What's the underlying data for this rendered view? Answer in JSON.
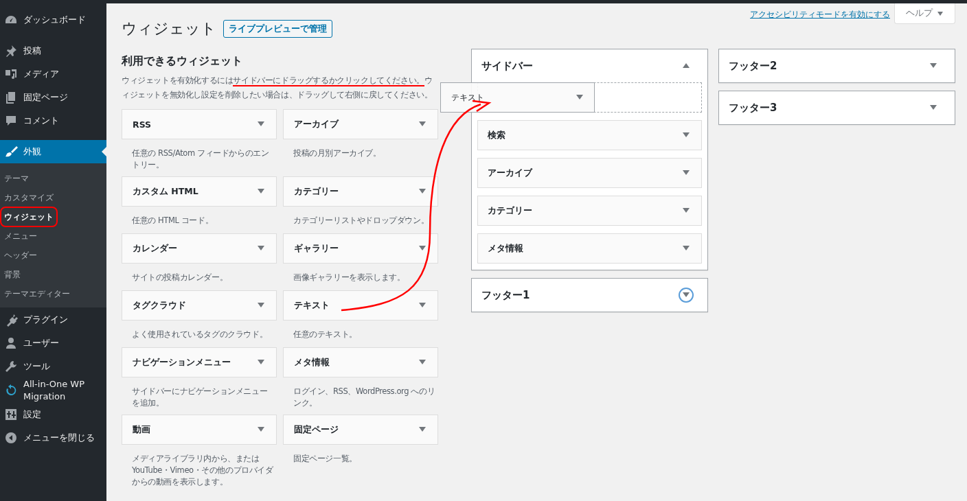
{
  "admin_menu": {
    "items": [
      {
        "label": "ダッシュボード",
        "selected": false
      },
      {
        "label": "投稿",
        "selected": false
      },
      {
        "label": "メディア",
        "selected": false
      },
      {
        "label": "固定ページ",
        "selected": false
      },
      {
        "label": "コメント",
        "selected": false
      },
      {
        "label": "外観",
        "selected": true,
        "submenu": [
          {
            "label": "テーマ",
            "selected": false,
            "circled": false
          },
          {
            "label": "カスタマイズ",
            "selected": false,
            "circled": false
          },
          {
            "label": "ウィジェット",
            "selected": true,
            "circled": true
          },
          {
            "label": "メニュー",
            "selected": false,
            "circled": false
          },
          {
            "label": "ヘッダー",
            "selected": false,
            "circled": false
          },
          {
            "label": "背景",
            "selected": false,
            "circled": false
          },
          {
            "label": "テーマエディター",
            "selected": false,
            "circled": false
          }
        ]
      },
      {
        "label": "プラグイン",
        "selected": false
      },
      {
        "label": "ユーザー",
        "selected": false
      },
      {
        "label": "ツール",
        "selected": false
      },
      {
        "label": "All-in-One WP Migration",
        "selected": false
      },
      {
        "label": "設定",
        "selected": false
      },
      {
        "label": "メニューを閉じる",
        "selected": false
      }
    ]
  },
  "screen_meta": {
    "accessibility_link": "アクセシビリティモードを有効にする",
    "help_tab": "ヘルプ"
  },
  "page_title": "ウィジェット",
  "live_preview_button": "ライブプレビューで管理",
  "available_widgets": {
    "heading": "利用できるウィジェット",
    "description": {
      "before": "ウィジェットを有効化するには",
      "underlined": "サイドバーにドラッグするかクリックしてください。",
      "after": "ウィジェットを無効化し設定を削除したい場合は、ドラッグして右側に戻してください。"
    },
    "widgets": [
      {
        "title": "RSS",
        "description": "任意の RSS/Atom フィードからのエントリー。"
      },
      {
        "title": "アーカイブ",
        "description": "投稿の月別アーカイブ。"
      },
      {
        "title": "カスタム HTML",
        "description": "任意の HTML コード。"
      },
      {
        "title": "カテゴリー",
        "description": "カテゴリーリストやドロップダウン。"
      },
      {
        "title": "カレンダー",
        "description": "サイトの投稿カレンダー。"
      },
      {
        "title": "ギャラリー",
        "description": "画像ギャラリーを表示します。"
      },
      {
        "title": "タグクラウド",
        "description": "よく使用されているタグのクラウド。"
      },
      {
        "title": "テキスト",
        "description": "任意のテキスト。"
      },
      {
        "title": "ナビゲーションメニュー",
        "description": "サイドバーにナビゲーションメニューを追加。"
      },
      {
        "title": "メタ情報",
        "description": "ログイン、RSS、WordPress.org へのリンク。"
      },
      {
        "title": "動画",
        "description": "メディアライブラリ内から、または YouTube・Vimeo・その他のプロバイダからの動画を表示します。"
      },
      {
        "title": "固定ページ",
        "description": "固定ページ一覧。"
      }
    ]
  },
  "widget_areas": {
    "columns": [
      [
        {
          "title": "サイドバー",
          "expanded": true,
          "focused": false,
          "dragging": {
            "title": "テキスト"
          },
          "widgets": [
            "検索",
            "アーカイブ",
            "カテゴリー",
            "メタ情報"
          ]
        },
        {
          "title": "フッター1",
          "expanded": false,
          "focused": true
        }
      ],
      [
        {
          "title": "フッター2",
          "expanded": false,
          "focused": false
        },
        {
          "title": "フッター3",
          "expanded": false,
          "focused": false
        }
      ]
    ]
  }
}
